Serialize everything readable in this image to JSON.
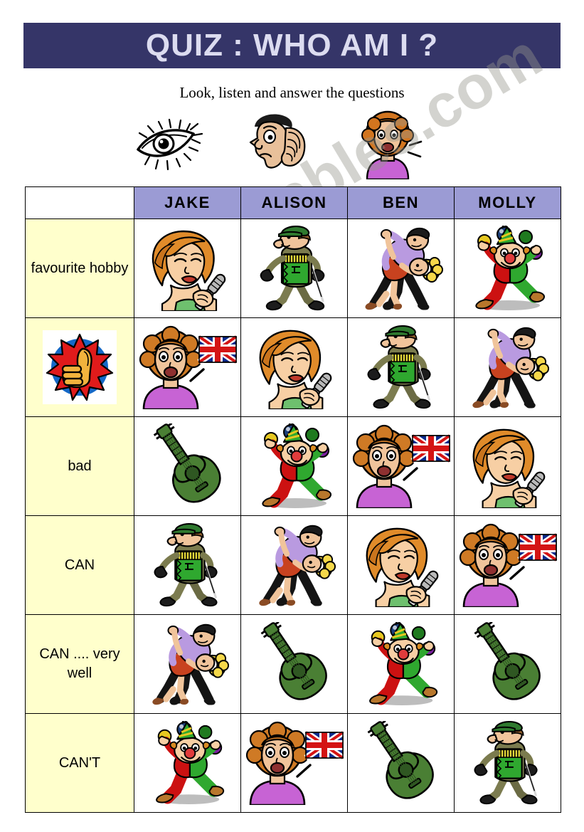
{
  "header": {
    "title": "QUIZ : WHO AM I ?",
    "subtitle": "Look, listen and answer the questions",
    "title_bg": "#353568",
    "title_color": "#dcdcf0"
  },
  "instruction_icons": [
    {
      "name": "eye-icon",
      "meaning": "Look"
    },
    {
      "name": "ear-listening-icon",
      "meaning": "listen"
    },
    {
      "name": "speaking-woman-icon",
      "meaning": "answer"
    }
  ],
  "watermark": {
    "text": "ESLprintables.com"
  },
  "table": {
    "colors": {
      "header_bg": "#9b9bd4",
      "label_bg": "#ffffcc",
      "cell_bg": "#ffffff",
      "border": "#000000"
    },
    "corner_label": "",
    "columns": [
      "JAKE",
      "ALISON",
      "BEN",
      "MOLLY"
    ],
    "rows": [
      {
        "label": "favourite hobby",
        "label_icon": "",
        "cells": [
          "singing-woman",
          "soldier-accordion",
          "dancing-couple",
          "juggling-clown"
        ]
      },
      {
        "label": "",
        "label_icon": "thumbs-up",
        "cells": [
          "speaking-english",
          "singing-woman",
          "soldier-accordion",
          "dancing-couple"
        ]
      },
      {
        "label": "bad",
        "label_icon": "",
        "cells": [
          "guitar",
          "juggling-clown",
          "speaking-english",
          "singing-woman"
        ]
      },
      {
        "label": "CAN",
        "label_icon": "",
        "cells": [
          "soldier-accordion",
          "dancing-couple",
          "singing-woman",
          "speaking-english"
        ]
      },
      {
        "label": "CAN .... very well",
        "label_icon": "",
        "cells": [
          "dancing-couple",
          "guitar",
          "juggling-clown",
          "guitar"
        ]
      },
      {
        "label": "CAN'T",
        "label_icon": "",
        "cells": [
          "juggling-clown",
          "speaking-english",
          "guitar",
          "soldier-accordion"
        ]
      }
    ]
  }
}
